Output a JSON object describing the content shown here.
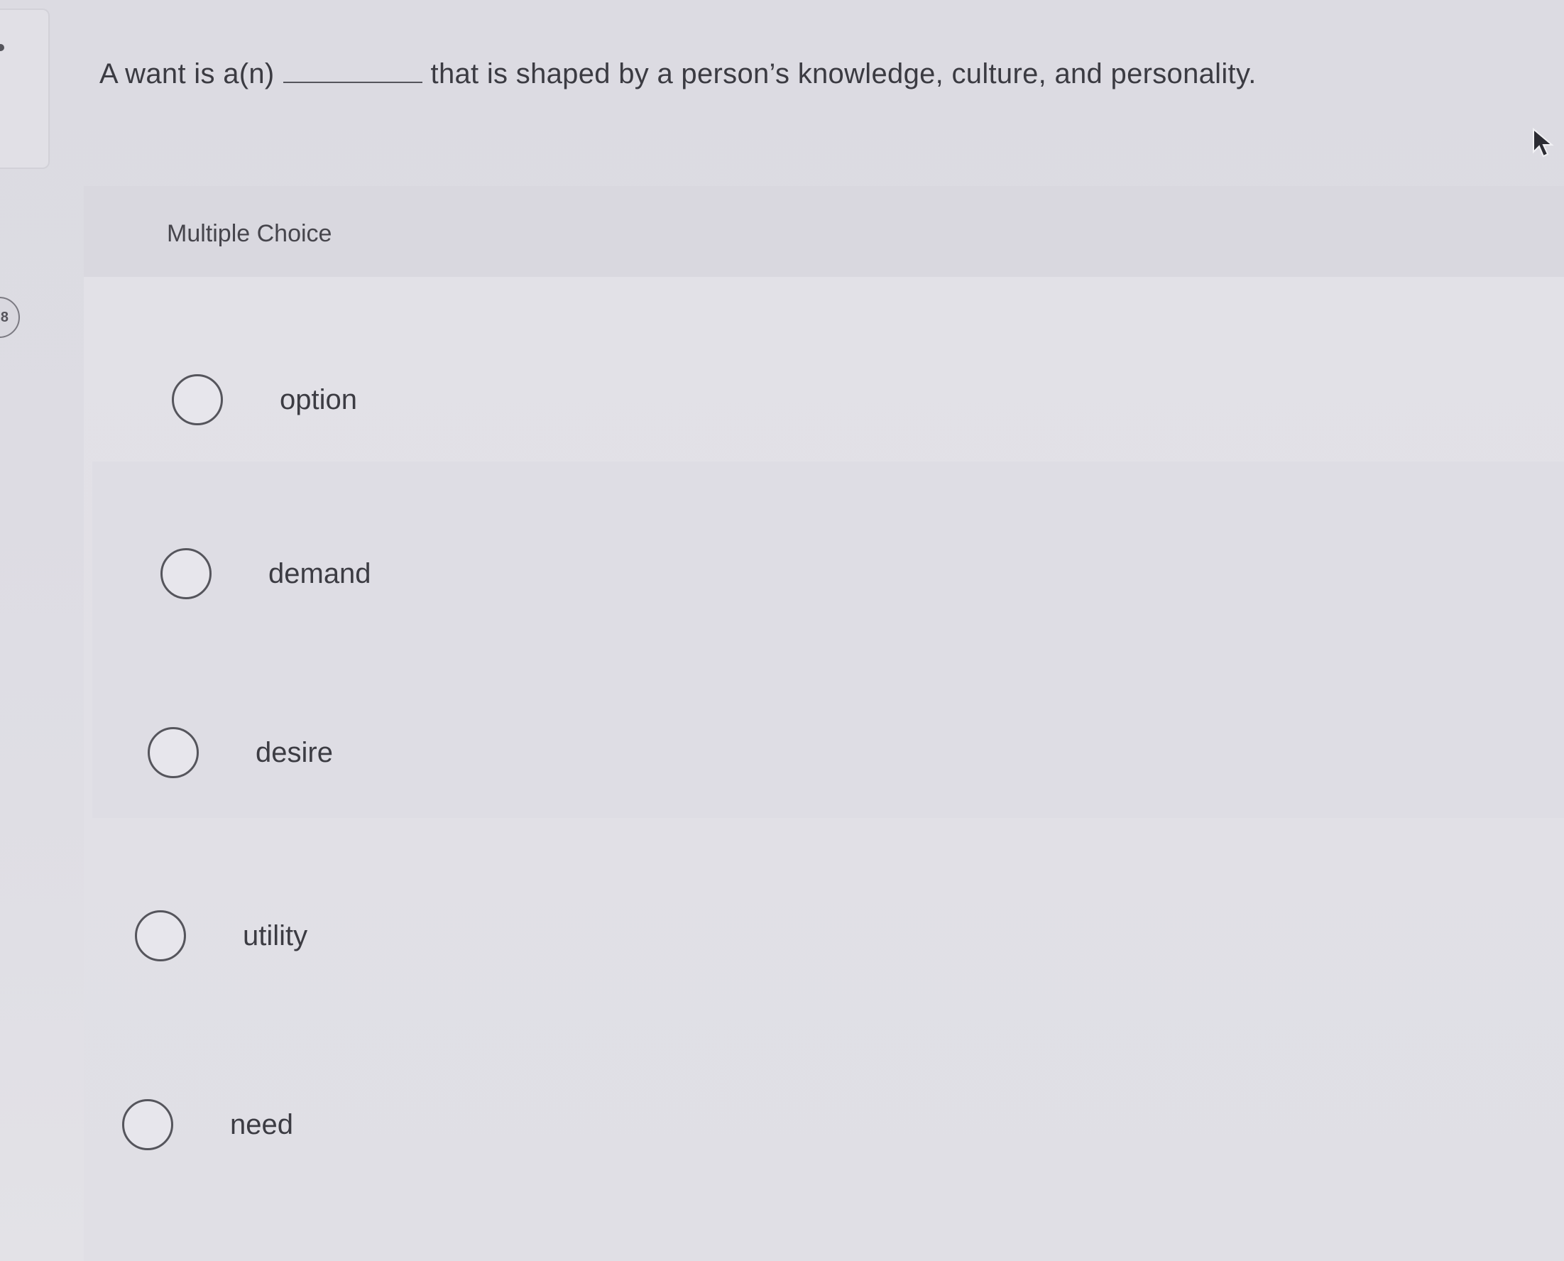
{
  "sidebar": {
    "question_number": "8"
  },
  "question": {
    "prefix": "A want is a(n)",
    "suffix": "that is shaped by a person’s knowledge, culture, and personality."
  },
  "section": {
    "label": "Multiple Choice"
  },
  "choices": [
    {
      "label": "option"
    },
    {
      "label": "demand"
    },
    {
      "label": "desire"
    },
    {
      "label": "utility"
    },
    {
      "label": "need"
    }
  ],
  "colors": {
    "background": "#dddce3",
    "header_band": "#d9d8df",
    "text": "#3b3b42",
    "radio_border": "#55555c"
  },
  "icons": {
    "cursor": "mouse-pointer-icon",
    "radio": "radio-circle-icon"
  }
}
